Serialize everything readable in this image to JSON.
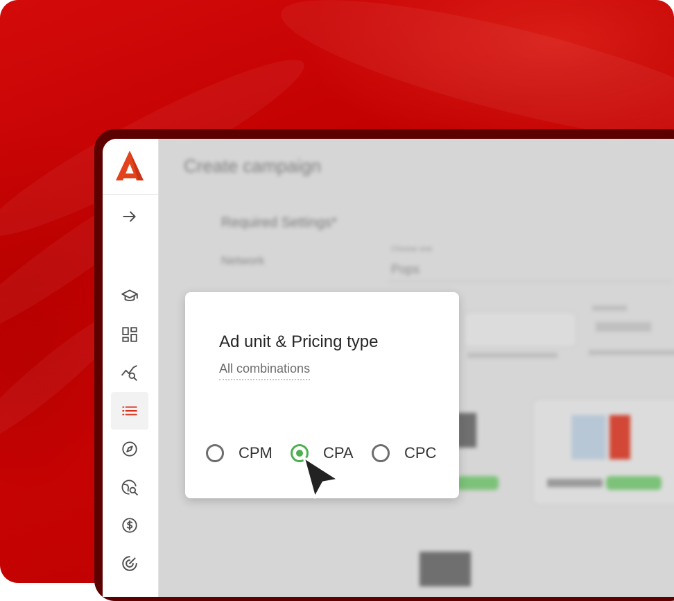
{
  "colors": {
    "brand": "#d72c16",
    "background_red": "#c10000",
    "radio_checked": "#4caf50"
  },
  "sidebar": {
    "logo": "arrow-logo",
    "toggle_icon": "arrow-right-icon",
    "items": [
      {
        "icon": "graduation-cap-icon"
      },
      {
        "icon": "dashboard-icon"
      },
      {
        "icon": "analytics-search-icon"
      },
      {
        "icon": "list-icon",
        "active": true
      },
      {
        "icon": "compass-icon"
      },
      {
        "icon": "globe-search-icon"
      },
      {
        "icon": "dollar-icon"
      },
      {
        "icon": "target-icon"
      }
    ]
  },
  "background_page": {
    "title": "Create campaign",
    "section_title": "Required Settings*",
    "row_label": "Network",
    "field_label": "Choose one",
    "field_value": "Pops"
  },
  "popup": {
    "title": "Ad unit & Pricing type",
    "subtitle": "All combinations",
    "options": [
      {
        "label": "CPM",
        "checked": false
      },
      {
        "label": "CPA",
        "checked": true
      },
      {
        "label": "CPC",
        "checked": false
      }
    ]
  }
}
